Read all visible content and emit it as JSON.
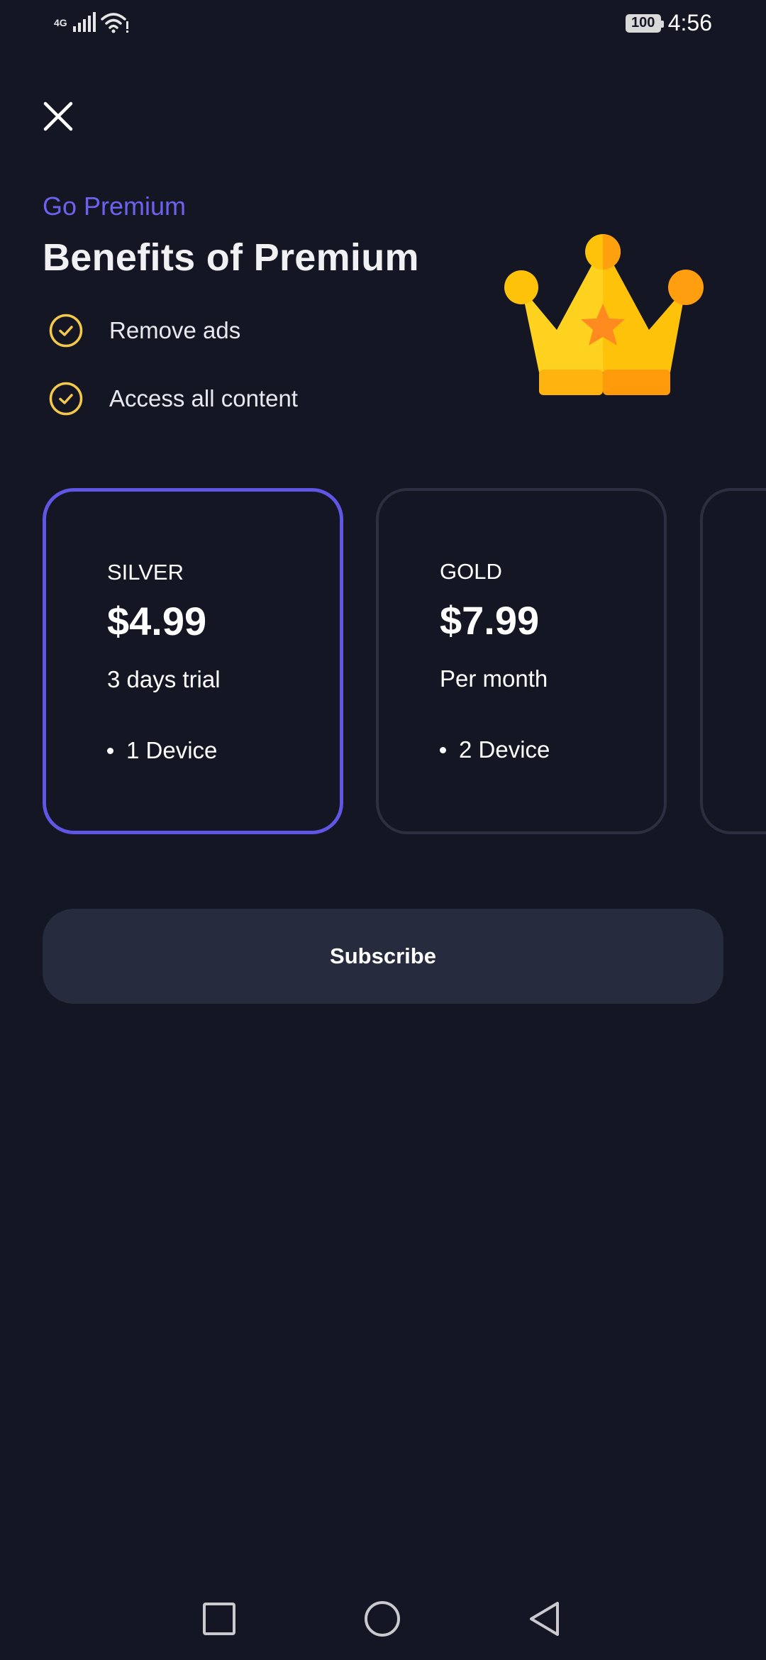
{
  "status_bar": {
    "network": "4G",
    "battery": "100",
    "time": "4:56"
  },
  "header": {
    "eyebrow": "Go Premium",
    "title": "Benefits of Premium"
  },
  "benefits": [
    {
      "label": "Remove ads"
    },
    {
      "label": "Access all content"
    }
  ],
  "plans": [
    {
      "tier": "SILVER",
      "price": "$4.99",
      "period": "3 days trial",
      "feature": "1 Device",
      "selected": true
    },
    {
      "tier": "GOLD",
      "price": "$7.99",
      "period": "Per month",
      "feature": "2 Device",
      "selected": false
    }
  ],
  "subscribe_label": "Subscribe",
  "colors": {
    "background": "#141624",
    "accent": "#6d62ee",
    "card_border": "#2b2f3f",
    "button_bg": "#262b3e",
    "check": "#f5c84a"
  },
  "icons": [
    "close-icon",
    "crown-icon",
    "check-circle-icon",
    "wifi-icon",
    "signal-icon",
    "battery-icon",
    "nav-recents-icon",
    "nav-home-icon",
    "nav-back-icon"
  ]
}
